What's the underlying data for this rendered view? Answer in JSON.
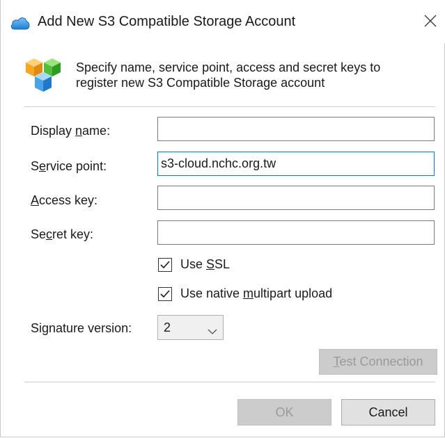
{
  "window": {
    "title": "Add New S3 Compatible Storage Account",
    "close_label": "×"
  },
  "header": {
    "description_line1": "Specify name, service point, access and secret keys to",
    "description_line2": "register new S3 Compatible Storage account"
  },
  "form": {
    "display_name": {
      "label_pre": "Display ",
      "label_mnemonic": "n",
      "label_post": "ame:",
      "value": ""
    },
    "service_point": {
      "label_pre": "S",
      "label_mnemonic": "e",
      "label_post": "rvice point:",
      "value": "s3-cloud.nchc.org.tw"
    },
    "access_key": {
      "label_pre": "",
      "label_mnemonic": "A",
      "label_post": "ccess key:",
      "value": ""
    },
    "secret_key": {
      "label_pre": "Se",
      "label_mnemonic": "c",
      "label_post": "ret key:",
      "value": ""
    },
    "use_ssl": {
      "label_pre": "Use ",
      "label_mnemonic": "S",
      "label_post": "SL",
      "checked": true
    },
    "use_multipart": {
      "label_pre": "Use native ",
      "label_mnemonic": "m",
      "label_post": "ultipart upload",
      "checked": true
    },
    "signature_version": {
      "label_pre": "Si",
      "label_mnemonic": "g",
      "label_post": "nature version:",
      "value": "2"
    }
  },
  "buttons": {
    "test_connection_mnemonic": "T",
    "test_connection_rest": "est Connection",
    "ok": "OK",
    "cancel": "Cancel"
  },
  "colors": {
    "accent": "#0078d7",
    "disabled_button": "#cccccc",
    "enabled_button": "#e1e1e1"
  }
}
